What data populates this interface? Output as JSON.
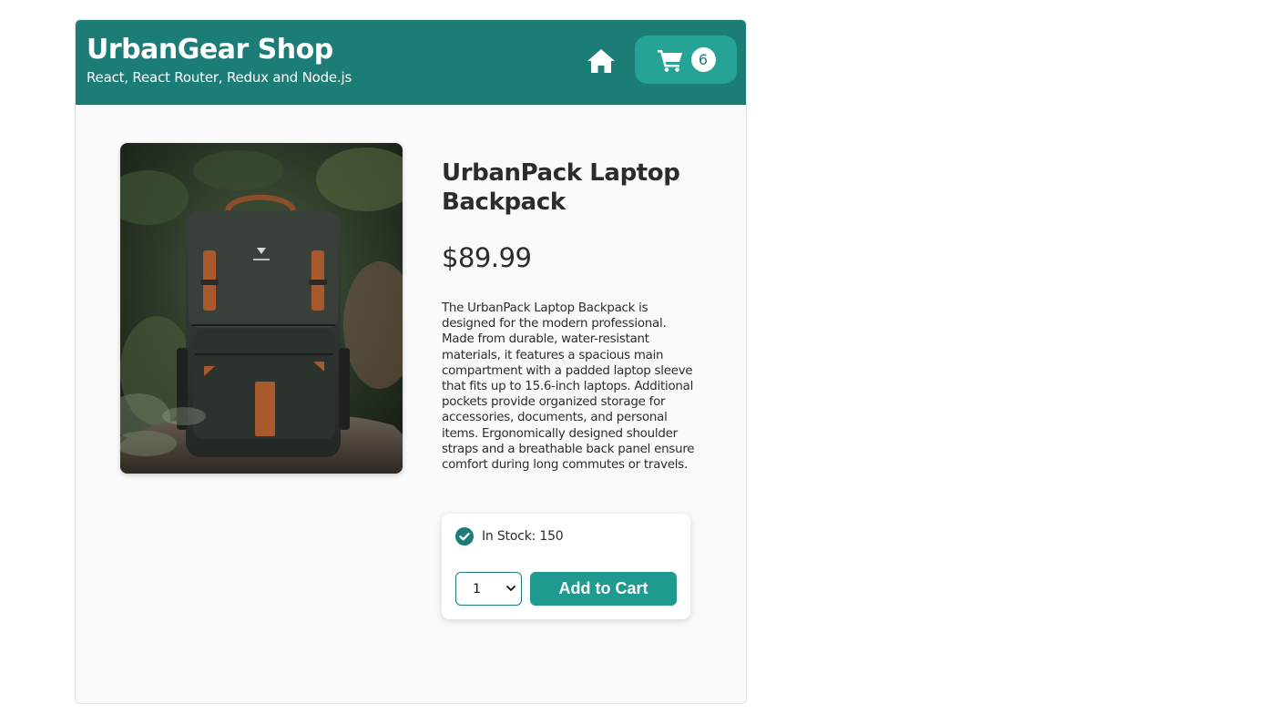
{
  "header": {
    "title": "UrbanGear Shop",
    "subtitle": "React, React Router, Redux and Node.js",
    "home_icon": "home-icon",
    "cart_icon": "shopping-cart-icon",
    "cart_count": "6"
  },
  "product": {
    "image_alt": "Dark green laptop backpack with brown leather straps on a rock",
    "title": "UrbanPack Laptop Backpack",
    "price": "$89.99",
    "description": "The UrbanPack Laptop Backpack is designed for the modern professional. Made from durable, water-resistant materials, it features a spacious main compartment with a padded laptop sleeve that fits up to 15.6-inch laptops. Additional pockets provide organized storage for accessories, documents, and personal items. Ergonomically designed shoulder straps and a breathable back panel ensure comfort during long commutes or travels."
  },
  "purchase": {
    "stock_icon": "check-circle-icon",
    "stock_text": "In Stock: 150",
    "quantity_selected": "1",
    "add_to_cart_label": "Add to Cart"
  },
  "colors": {
    "header_bg": "#1b7d76",
    "accent": "#26a397",
    "button_bg": "#1f9a8f"
  }
}
